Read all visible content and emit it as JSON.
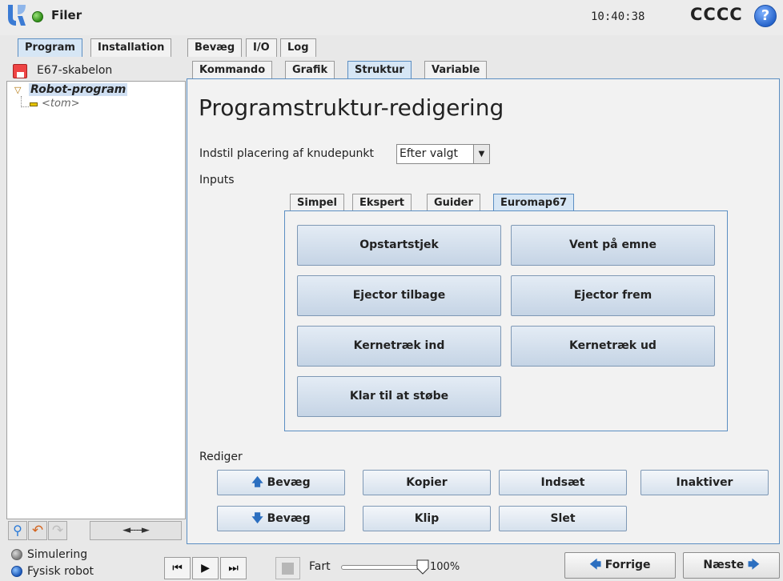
{
  "header": {
    "files_label": "Filer",
    "clock": "10:40:38",
    "robot_name": "CCCC",
    "help_glyph": "?"
  },
  "main_tabs": [
    "Program",
    "Installation",
    "Bevæg",
    "I/O",
    "Log"
  ],
  "main_tabs_active": "Program",
  "sub_tabs": [
    "Kommando",
    "Grafik",
    "Struktur",
    "Variable"
  ],
  "sub_tabs_active": "Struktur",
  "left": {
    "file_name": "E67-skabelon",
    "tree_root": "Robot-program",
    "tree_leaf": "<tom>",
    "expand_glyph": "◄----►"
  },
  "content": {
    "title": "Programstruktur-redigering",
    "placement_label": "Indstil placering af knudepunkt",
    "placement_value": "Efter valgt",
    "inputs_label": "Inputs",
    "input_tabs": [
      "Simpel",
      "Ekspert",
      "Guider",
      "Euromap67"
    ],
    "input_tabs_active": "Euromap67",
    "euromap_buttons": [
      "Opstartstjek",
      "Vent på emne",
      "Ejector tilbage",
      "Ejector frem",
      "Kernetræk ind",
      "Kernetræk ud",
      "Klar til at støbe"
    ],
    "edit_label": "Rediger",
    "edit_buttons": {
      "move_up": "Bevæg",
      "copy": "Kopier",
      "paste": "Indsæt",
      "disable": "Inaktiver",
      "move_down": "Bevæg",
      "cut": "Klip",
      "delete": "Slet"
    }
  },
  "footer": {
    "simulation": "Simulering",
    "physical": "Fysisk robot",
    "mode_selected": "Fysisk robot",
    "speed_label": "Fart",
    "speed_value": "100%",
    "speed_fraction": 1.0,
    "prev": "Forrige",
    "next": "Næste"
  },
  "colors": {
    "active_tab": "#d6e6f5",
    "accent_blue": "#2c6fc0",
    "panel_border": "#5b8ec2"
  }
}
